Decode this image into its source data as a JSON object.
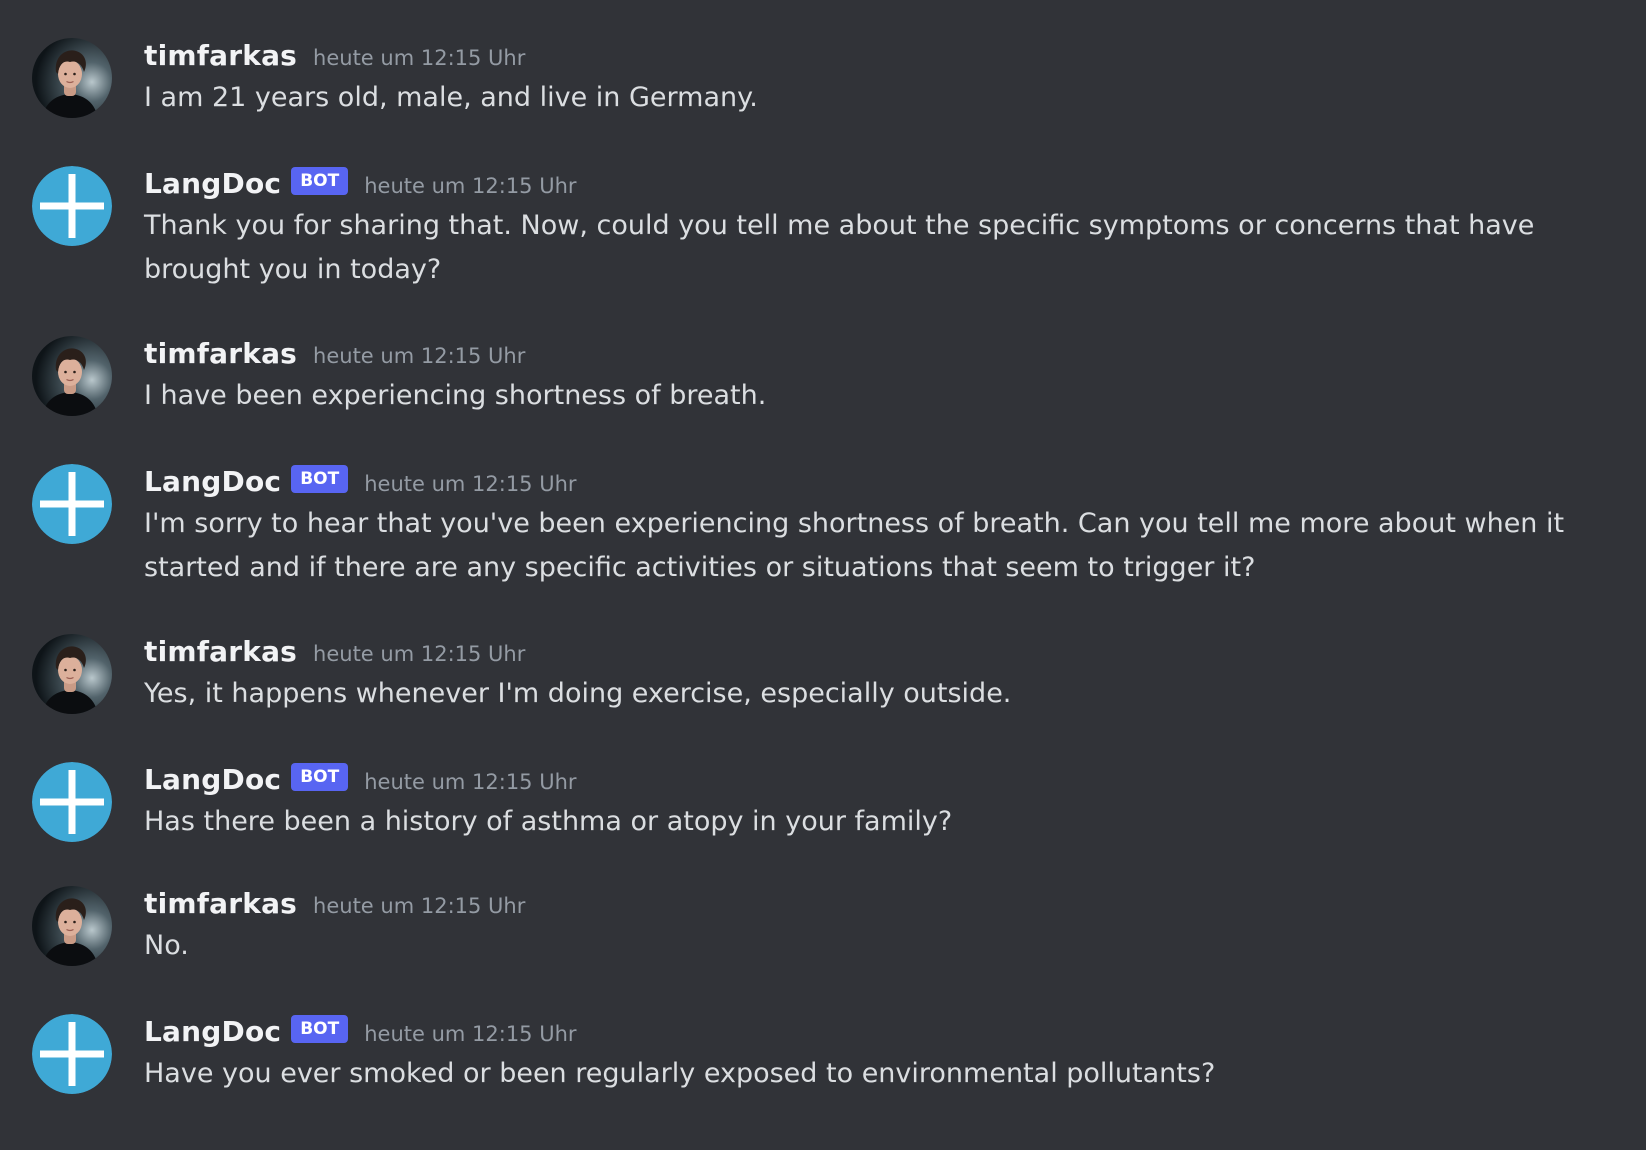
{
  "colors": {
    "background": "#313338",
    "username": "#f2f3f5",
    "text": "#dbdee1",
    "timestamp": "#949ba4",
    "bot_tag": "#5865f2",
    "bot_avatar": "#3fa9d6"
  },
  "messages": [
    {
      "author": "timfarkas",
      "avatar_icon": "user-photo-avatar",
      "is_bot": false,
      "timestamp": "heute um 12:15 Uhr",
      "content": "I am 21 years old, male, and live in Germany."
    },
    {
      "author": "LangDoc",
      "avatar_icon": "cross-icon",
      "is_bot": true,
      "bot_tag": "BOT",
      "timestamp": "heute um 12:15 Uhr",
      "content": "Thank you for sharing that. Now, could you tell me about the specific symptoms or concerns that have brought you in today?"
    },
    {
      "author": "timfarkas",
      "avatar_icon": "user-photo-avatar",
      "is_bot": false,
      "timestamp": "heute um 12:15 Uhr",
      "content": "I have been experiencing shortness of breath."
    },
    {
      "author": "LangDoc",
      "avatar_icon": "cross-icon",
      "is_bot": true,
      "bot_tag": "BOT",
      "timestamp": "heute um 12:15 Uhr",
      "content": "I'm sorry to hear that you've been experiencing shortness of breath. Can you tell me more about when it started and if there are any specific activities or situations that seem to trigger it?"
    },
    {
      "author": "timfarkas",
      "avatar_icon": "user-photo-avatar",
      "is_bot": false,
      "timestamp": "heute um 12:15 Uhr",
      "content": "Yes, it happens whenever I'm doing exercise, especially outside."
    },
    {
      "author": "LangDoc",
      "avatar_icon": "cross-icon",
      "is_bot": true,
      "bot_tag": "BOT",
      "timestamp": "heute um 12:15 Uhr",
      "content": "Has there been a history of asthma or atopy in your family?"
    },
    {
      "author": "timfarkas",
      "avatar_icon": "user-photo-avatar",
      "is_bot": false,
      "timestamp": "heute um 12:15 Uhr",
      "content": "No."
    },
    {
      "author": "LangDoc",
      "avatar_icon": "cross-icon",
      "is_bot": true,
      "bot_tag": "BOT",
      "timestamp": "heute um 12:15 Uhr",
      "content": "Have you ever smoked or been regularly exposed to environmental pollutants?"
    }
  ]
}
